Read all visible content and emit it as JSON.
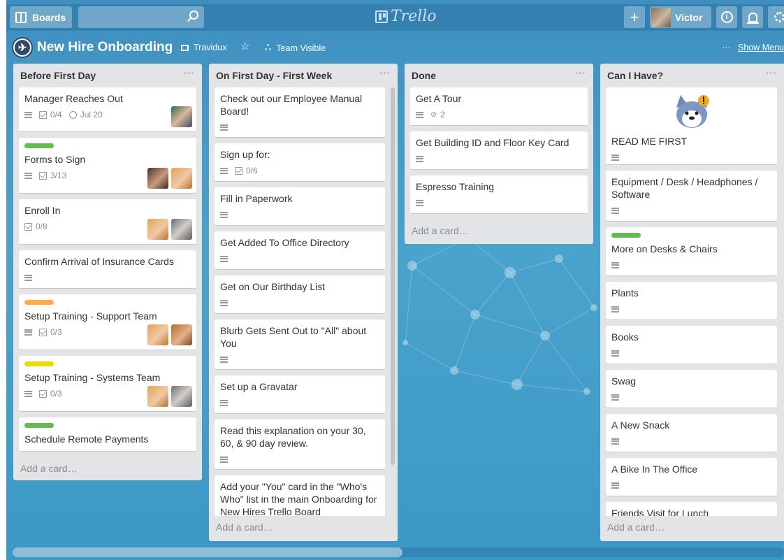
{
  "header": {
    "boards_label": "Boards",
    "logo_text": "Trello",
    "user_name": "Victor"
  },
  "board": {
    "title": "New Hire Onboarding",
    "org": "Travidux",
    "visibility": "Team Visible",
    "show_menu": "Show Menu",
    "menu_dots": "···"
  },
  "lists": [
    {
      "title": "Before First Day",
      "add_card": "Add a card…",
      "cards": [
        {
          "title": "Manager Reaches Out",
          "checklist": "0/4",
          "due": "Jul 20"
        },
        {
          "title": "Forms to Sign",
          "checklist": "3/13",
          "label_color": "#61bd4f"
        },
        {
          "title": "Enroll In",
          "checklist": "0/8"
        },
        {
          "title": "Confirm Arrival of Insurance Cards"
        },
        {
          "title": "Setup Training - Support Team",
          "checklist": "0/3",
          "label_color": "#ffab4a"
        },
        {
          "title": "Setup Training - Systems Team",
          "checklist": "0/3",
          "label_color": "#f2d600"
        },
        {
          "title": "Schedule Remote Payments",
          "label_color": "#61bd4f"
        }
      ]
    },
    {
      "title": "On First Day - First Week",
      "add_card": "Add a card…",
      "cards": [
        {
          "title": "Check out our Employee Manual Board!"
        },
        {
          "title": "Sign up for:",
          "checklist": "0/6"
        },
        {
          "title": "Fill in Paperwork"
        },
        {
          "title": "Get Added To Office Directory"
        },
        {
          "title": "Get on Our Birthday List"
        },
        {
          "title": "Blurb Gets Sent Out to \"All\" about You"
        },
        {
          "title": "Set up a Gravatar"
        },
        {
          "title": "Read this explanation on your 30, 60, & 90 day review."
        },
        {
          "title": "Add your \"You\" card in the \"Who's Who\" list in the main Onboarding for New Hires Trello Board"
        }
      ]
    },
    {
      "title": "Done",
      "add_card": "Add a card…",
      "cards": [
        {
          "title": "Get A Tour",
          "attachments": "2"
        },
        {
          "title": "Get Building ID and Floor Key Card"
        },
        {
          "title": "Espresso Training"
        }
      ]
    },
    {
      "title": "Can I Have?",
      "add_card": "Add a card…",
      "cards": [
        {
          "title": "READ ME FIRST"
        },
        {
          "title": "Equipment / Desk / Headphones / Software"
        },
        {
          "title": "More on Desks & Chairs",
          "label_color": "#61bd4f"
        },
        {
          "title": "Plants"
        },
        {
          "title": "Books"
        },
        {
          "title": "Swag"
        },
        {
          "title": "A New Snack"
        },
        {
          "title": "A Bike In The Office"
        },
        {
          "title": "Friends Visit for Lunch"
        }
      ]
    }
  ],
  "colors": {
    "label_green": "#61bd4f",
    "label_orange": "#ffab4a",
    "label_yellow": "#f2d600"
  },
  "icons": [
    "boards-icon",
    "search-icon",
    "plus-icon",
    "info-icon",
    "bell-icon",
    "gear-icon",
    "star-icon",
    "description-icon",
    "checklist-icon",
    "clock-icon",
    "attachment-icon"
  ]
}
